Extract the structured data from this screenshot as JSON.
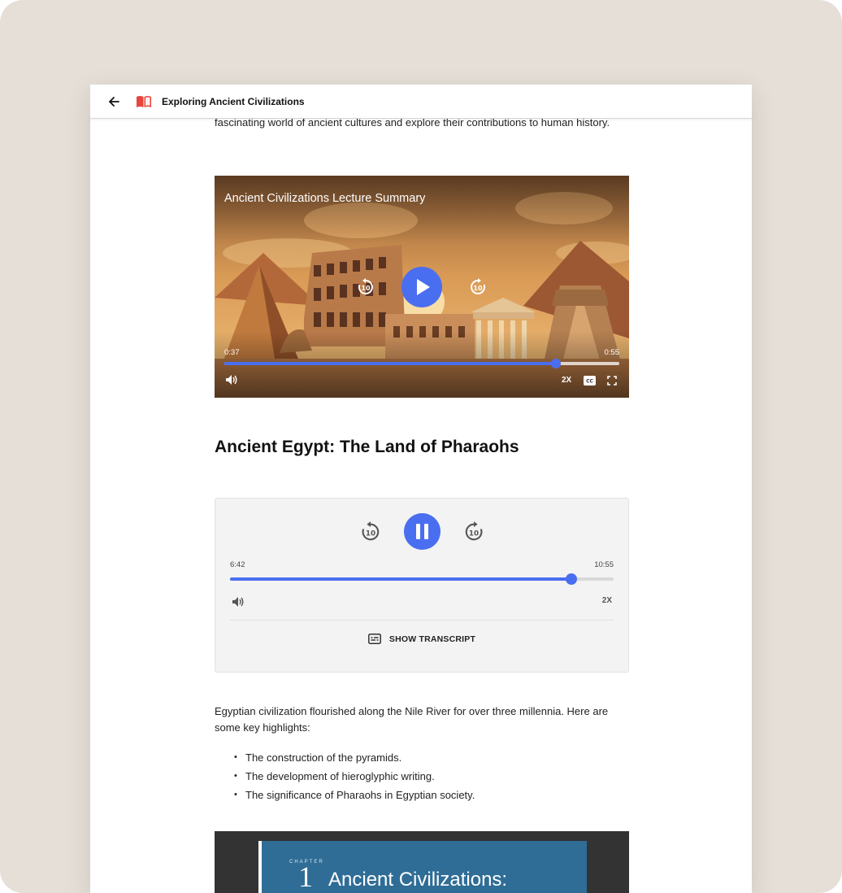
{
  "header": {
    "title": "Exploring Ancient Civilizations"
  },
  "intro_text": "fascinating world of ancient cultures and explore their contributions to human history.",
  "video": {
    "title": "Ancient Civilizations Lecture Summary",
    "current_time": "0:37",
    "duration": "0:55",
    "progress_fraction": 0.84,
    "speed": "2X",
    "cc_label": "CC"
  },
  "section_heading": "Ancient Egypt: The Land of Pharaohs",
  "audio": {
    "current_time": "6:42",
    "duration": "10:55",
    "progress_fraction": 0.89,
    "speed": "2X",
    "transcript_label": "SHOW TRANSCRIPT"
  },
  "body_text": "Egyptian civilization flourished along the Nile River for over three millennia. Here are some key highlights:",
  "highlights": [
    "The construction of the pyramids.",
    "The development of hieroglyphic writing.",
    "The significance of Pharaohs in Egyptian society."
  ],
  "chapter": {
    "label": "CHAPTER",
    "number": "1",
    "title": "Ancient Civilizations:"
  },
  "colors": {
    "accent": "#4a6ef0",
    "brand_icon": "#e8453c",
    "chapter_bg": "#2f6d96"
  }
}
